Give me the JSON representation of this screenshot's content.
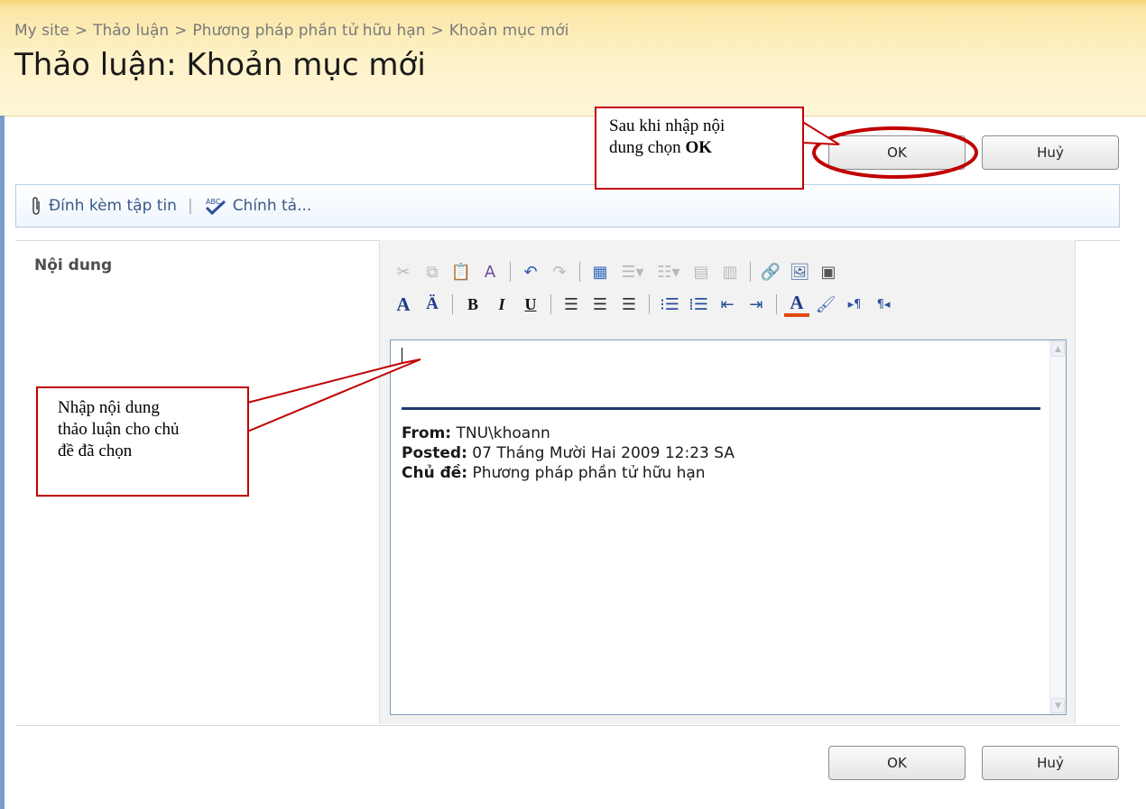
{
  "breadcrumb": [
    "My site",
    "Thảo luận",
    "Phương pháp phần tử hữu hạn",
    "Khoản mục mới"
  ],
  "breadcrumb_separator": ">",
  "page_title": "Thảo luận: Khoản mục mới",
  "buttons": {
    "ok": "OK",
    "cancel": "Huỷ"
  },
  "toolbar": {
    "attach": "Đính kèm tập tin",
    "divider": "|",
    "spelling": "Chính tả..."
  },
  "form": {
    "field_label": "Nội dung"
  },
  "editor": {
    "quote": {
      "from_label": "From:",
      "from_value": "TNU\\khoann",
      "posted_label": "Posted:",
      "posted_value": "07 Tháng Mười Hai 2009 12:23 SA",
      "topic_label": "Chủ đề:",
      "topic_value": "Phương pháp phần tử hữu hạn"
    }
  },
  "annotations": {
    "ok_note_line1": "Sau khi nhập nội",
    "ok_note_line2_text": "dung chọn ",
    "ok_note_line2_bold": "OK",
    "content_note_line1": "Nhập nội dung",
    "content_note_line2": "thảo luận cho chủ",
    "content_note_line3": "đề đã chọn",
    "callout_color": "#c00000"
  },
  "colors": {
    "header_bg": "#fce8a8",
    "link_text": "#3a5a89",
    "quote_rule": "#1f3a6e"
  }
}
